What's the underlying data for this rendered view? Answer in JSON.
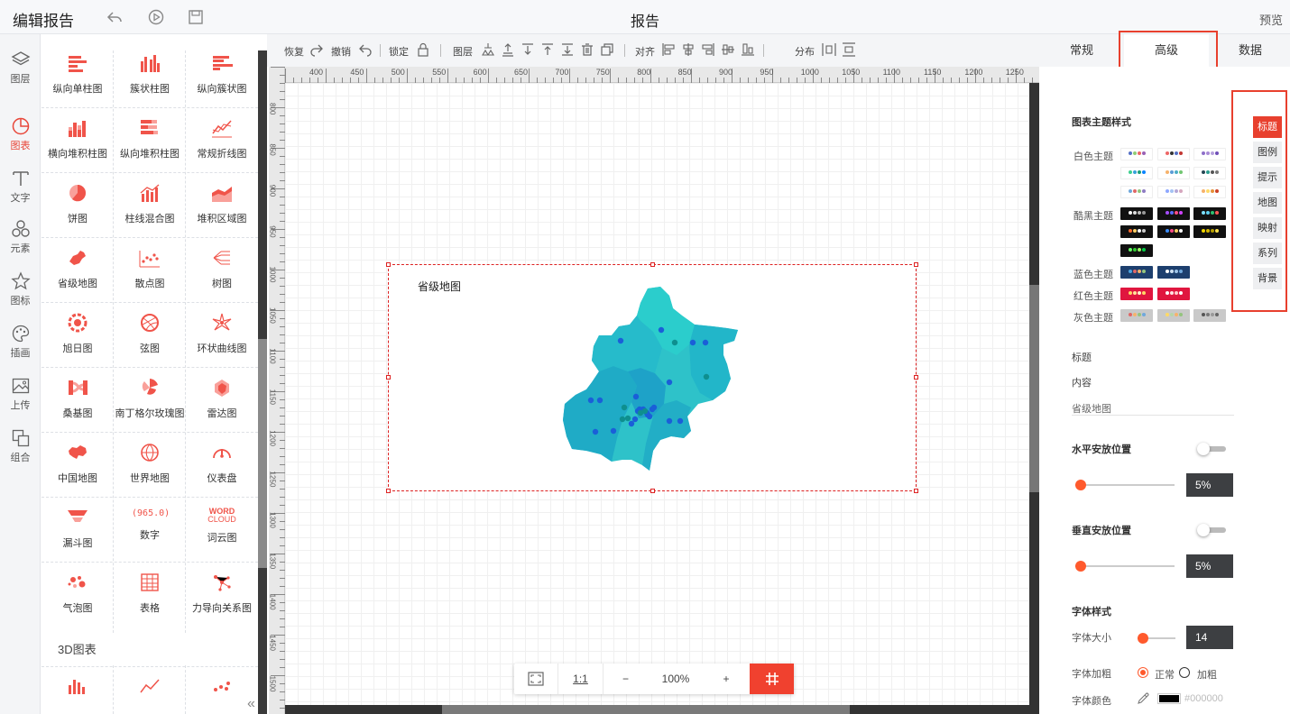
{
  "header": {
    "title": "编辑报告",
    "page_title": "报告",
    "preview": "预览"
  },
  "rail": [
    {
      "label": "图层",
      "icon": "layers-icon"
    },
    {
      "label": "图表",
      "icon": "pie-chart-icon",
      "active": true
    },
    {
      "label": "文字",
      "icon": "text-icon"
    },
    {
      "label": "元素",
      "icon": "shapes-icon"
    },
    {
      "label": "图标",
      "icon": "star-icon"
    },
    {
      "label": "插画",
      "icon": "palette-icon"
    },
    {
      "label": "上传",
      "icon": "image-upload-icon"
    },
    {
      "label": "组合",
      "icon": "group-icon"
    }
  ],
  "components": [
    "纵向单柱图",
    "簇状柱图",
    "纵向簇状图",
    "横向堆积柱图",
    "纵向堆积柱图",
    "常规折线图",
    "饼图",
    "柱线混合图",
    "堆积区域图",
    "省级地图",
    "散点图",
    "树图",
    "旭日图",
    "弦图",
    "环状曲线图",
    "桑基图",
    "南丁格尔玫瑰图",
    "雷达图",
    "中国地图",
    "世界地图",
    "仪表盘",
    "漏斗图",
    "数字",
    "词云图",
    "气泡图",
    "表格",
    "力导向关系图"
  ],
  "number_icon_text": "965.0",
  "wordcloud_icon_text": [
    "WORD",
    "CLOUD"
  ],
  "section_3d": "3D图表",
  "toolbar": {
    "redo": "恢复",
    "undo": "撤销",
    "lock": "锁定",
    "layer": "图层",
    "align": "对齐",
    "distribute": "分布"
  },
  "ruler_top": [
    "400",
    "450",
    "500",
    "550",
    "600",
    "650",
    "700",
    "750",
    "800",
    "850",
    "900",
    "950",
    "1000",
    "1050",
    "1100",
    "1150",
    "1200",
    "1250"
  ],
  "ruler_left": [
    "800",
    "850",
    "900",
    "950",
    "1000",
    "1050",
    "1100",
    "1150",
    "1200",
    "1250",
    "1300",
    "1350",
    "1400",
    "1450",
    "1500"
  ],
  "chart": {
    "title": "省级地图",
    "region_color": "#2ec2c9",
    "point_color": "#1a5fd8"
  },
  "zoom": {
    "ratio": "1:1",
    "minus": "−",
    "value": "100%",
    "plus": "+"
  },
  "tabs": {
    "normal": "常规",
    "advanced": "高级",
    "data": "数据"
  },
  "props": {
    "theme_heading": "图表主题样式",
    "white_theme": "白色主题",
    "dark_theme": "酷黑主题",
    "blue_theme": "蓝色主题",
    "red_theme": "红色主题",
    "gray_theme": "灰色主题",
    "title_label": "标题",
    "content_label": "内容",
    "content_value": "省级地图",
    "h_pos_label": "水平安放位置",
    "h_pos_value": "5%",
    "v_pos_label": "垂直安放位置",
    "v_pos_value": "5%",
    "font_style_label": "字体样式",
    "font_size_label": "字体大小",
    "font_size_value": "14",
    "font_weight_label": "字体加粗",
    "weight_normal": "正常",
    "weight_bold": "加粗",
    "font_color_label": "字体颜色",
    "font_color_value": "#000000"
  },
  "side_nav": [
    "标题",
    "图例",
    "提示",
    "地图",
    "映射",
    "系列",
    "背景"
  ],
  "colors": {
    "accent": "#e8402e",
    "icon_red": "#f0544a"
  }
}
